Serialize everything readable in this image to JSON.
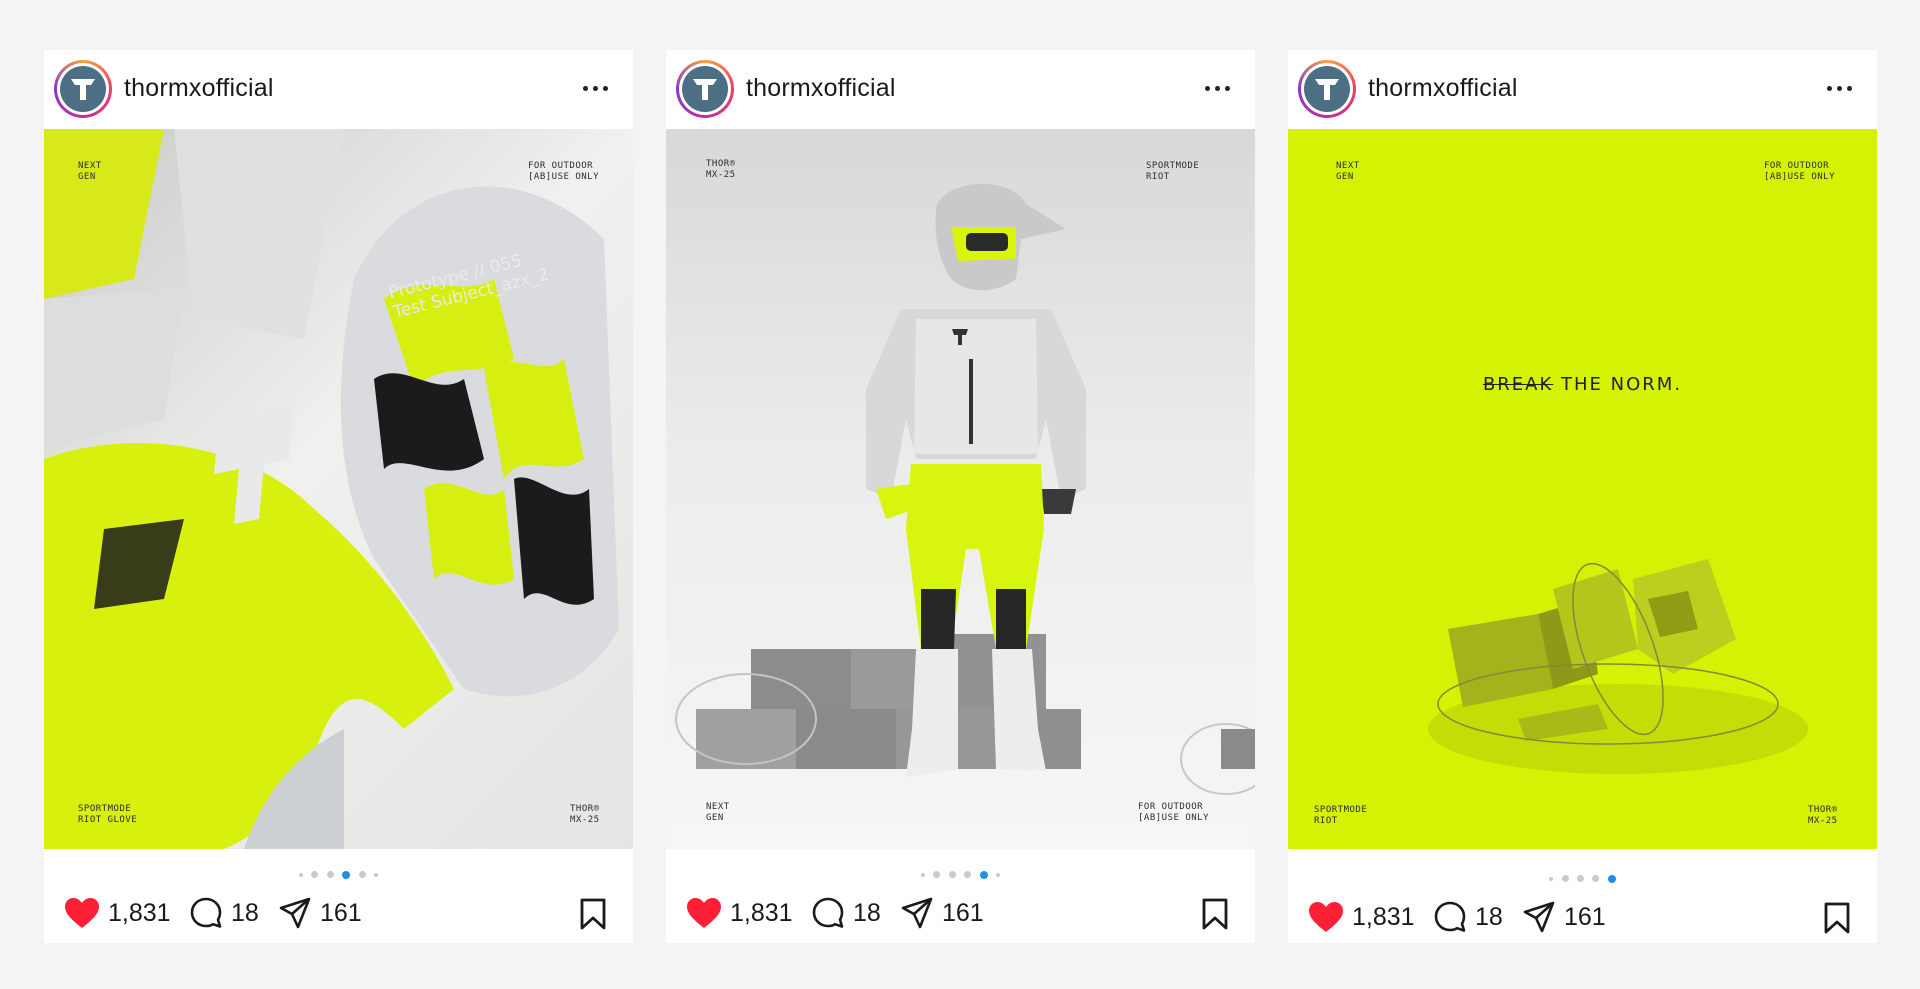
{
  "colors": {
    "like_red": "#ff2038",
    "active_dot": "#1e8fe8",
    "neon_yellow": "#d4f204",
    "avatar_blue": "#4d6f86"
  },
  "posts": [
    {
      "username": "thormxofficial",
      "likes": "1,831",
      "comments": "18",
      "shares": "161",
      "carousel": {
        "count": 6,
        "active_index": 3
      },
      "media": {
        "top_left": "NEXT\nGEN",
        "top_right": "FOR OUTDOOR\n[AB]USE ONLY",
        "bottom_left": "SPORTMODE\nRIOT GLOVE",
        "bottom_right": "THOR®\nMX-25",
        "glove_print": "Prototype // 055\nTest Subject_azx_2"
      }
    },
    {
      "username": "thormxofficial",
      "likes": "1,831",
      "comments": "18",
      "shares": "161",
      "carousel": {
        "count": 6,
        "active_index": 4
      },
      "media": {
        "top_left": "THOR®\nMX-25",
        "top_right": "SPORTMODE\nRIOT",
        "bottom_left": "NEXT\nGEN",
        "bottom_right": "FOR OUTDOOR\n[AB]USE ONLY"
      }
    },
    {
      "username": "thormxofficial",
      "likes": "1,831",
      "comments": "18",
      "shares": "161",
      "carousel": {
        "count": 5,
        "active_index": 4
      },
      "media": {
        "top_left": "NEXT\nGEN",
        "top_right": "FOR OUTDOOR\n[AB]USE ONLY",
        "bottom_left": "SPORTMODE\nRIOT",
        "bottom_right": "THOR®\nMX-25",
        "headline_struck": "BREAK",
        "headline_rest": " THE NORM."
      }
    }
  ]
}
